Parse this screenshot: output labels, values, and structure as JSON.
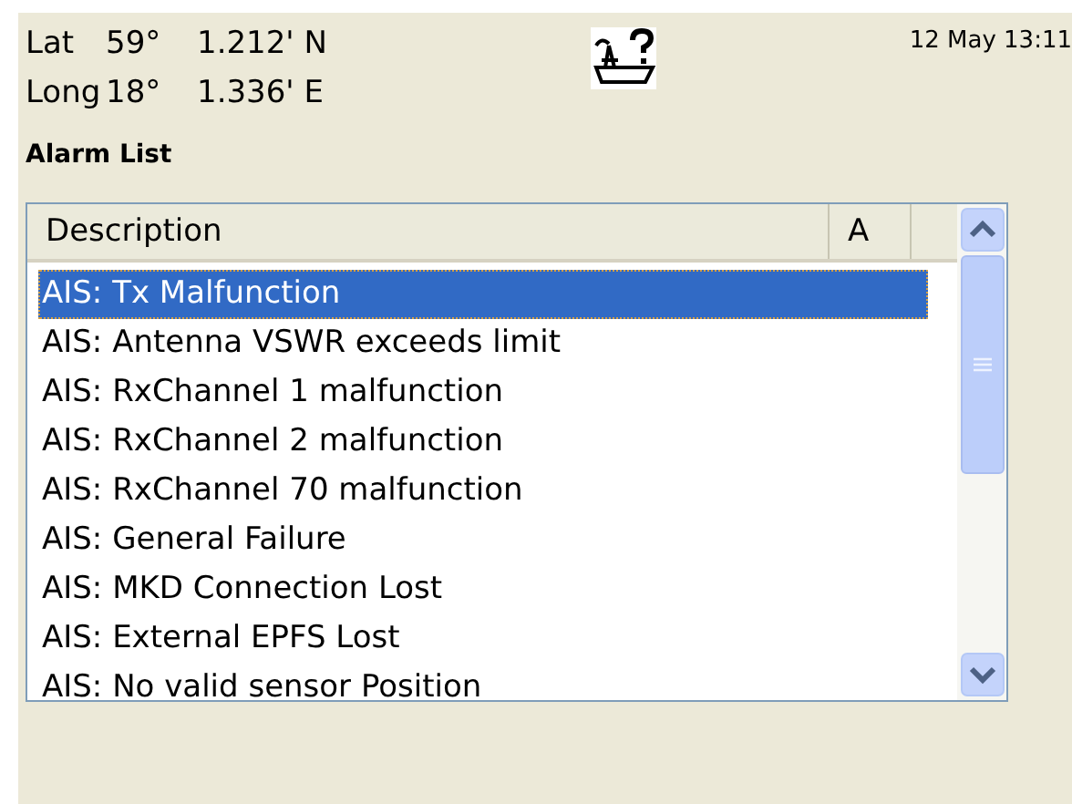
{
  "position": {
    "lat_label": "Lat",
    "lat_deg": "59°",
    "lat_min": "1.212' N",
    "long_label": "Long",
    "long_deg": "18°",
    "long_min": "1.336' E"
  },
  "datetime": "12 May 13:11",
  "title": "Alarm List",
  "table": {
    "columns": [
      "Description",
      "A"
    ],
    "rows": [
      {
        "description": "AIS: Tx Malfunction",
        "selected": true
      },
      {
        "description": "AIS: Antenna VSWR exceeds limit",
        "selected": false
      },
      {
        "description": "AIS: RxChannel 1 malfunction",
        "selected": false
      },
      {
        "description": "AIS: RxChannel 2 malfunction",
        "selected": false
      },
      {
        "description": "AIS: RxChannel 70 malfunction",
        "selected": false
      },
      {
        "description": "AIS: General Failure",
        "selected": false
      },
      {
        "description": "AIS: MKD Connection Lost",
        "selected": false
      },
      {
        "description": "AIS: External EPFS Lost",
        "selected": false
      },
      {
        "description": "AIS: No valid sensor Position",
        "selected": false
      }
    ]
  }
}
